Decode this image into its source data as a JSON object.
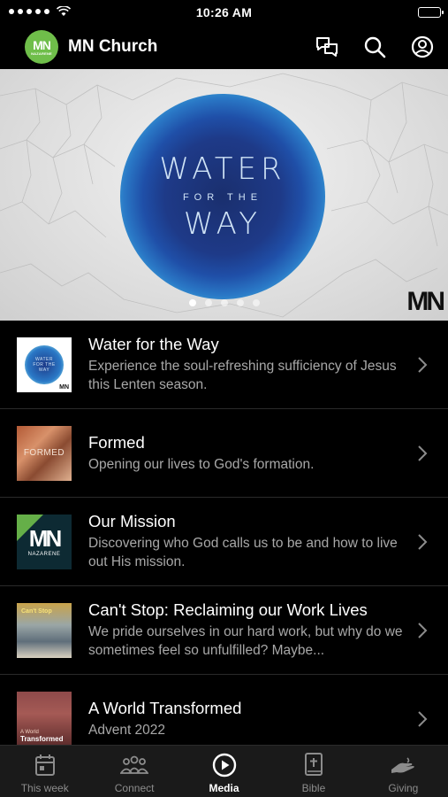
{
  "status_bar": {
    "time": "10:26 AM"
  },
  "header": {
    "logo_text": "MN",
    "logo_subtext": "NAZARENE",
    "title": "MN Church"
  },
  "hero": {
    "line1": "WATER",
    "line2": "FOR THE",
    "line3": "WAY",
    "watermark": "MN",
    "carousel_count": 5,
    "carousel_active": 0
  },
  "media_list": [
    {
      "title": "Water for the Way",
      "subtitle": "Experience the soul-refreshing sufficiency of Jesus this Lenten season.",
      "thumb_text": "WATER FOR THE WAY"
    },
    {
      "title": "Formed",
      "subtitle": "Opening our lives to God's formation.",
      "thumb_text": "FORMED"
    },
    {
      "title": "Our Mission",
      "subtitle": "Discovering who God calls us to be and how to live out His mission.",
      "thumb_text": "MN",
      "thumb_subtext": "NAZARENE"
    },
    {
      "title": "Can't Stop: Reclaiming our Work Lives",
      "subtitle": "We pride ourselves in our hard work, but why do we sometimes feel so unfulfilled? Maybe...",
      "thumb_text": "Can't Stop"
    },
    {
      "title": "A World Transformed",
      "subtitle": "Advent 2022",
      "thumb_text": "A World",
      "thumb_subtext": "Transformed"
    }
  ],
  "tabs": [
    {
      "label": "This week",
      "icon": "calendar-icon",
      "active": false
    },
    {
      "label": "Connect",
      "icon": "people-icon",
      "active": false
    },
    {
      "label": "Media",
      "icon": "play-circle-icon",
      "active": true
    },
    {
      "label": "Bible",
      "icon": "bible-icon",
      "active": false
    },
    {
      "label": "Giving",
      "icon": "giving-hand-icon",
      "active": false
    }
  ],
  "colors": {
    "brand_green": "#6fbe4a",
    "background": "#000000",
    "tab_bar": "#1a1a1a",
    "subtitle": "#a8a8a8"
  }
}
